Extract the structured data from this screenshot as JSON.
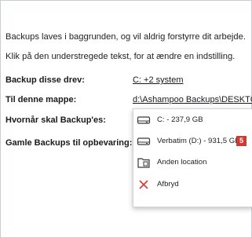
{
  "intro": {
    "line1": "Backups laves i baggrunden, og vil aldrig forstyrre dit arbejde.",
    "line2": "Klik på den understregede tekst, for at ændre en indstilling."
  },
  "settings": [
    {
      "label": "Backup disse drev:",
      "value": "C: +2 system"
    },
    {
      "label": "Til denne mappe:",
      "value": "d:\\Ashampoo Backups\\DESKTC"
    },
    {
      "label": "Hvornår skal Backup'es:",
      "value": ""
    },
    {
      "label": "Gamle Backups til opbevaring:",
      "value": ""
    }
  ],
  "dropdown": {
    "items": [
      {
        "label": "C: - 237,9 GB",
        "icon": "drive-icon"
      },
      {
        "label": "Verbatim (D:) - 931,5 GB",
        "icon": "drive-icon",
        "badge": "5"
      },
      {
        "label": "Anden location",
        "icon": "folder-icon"
      },
      {
        "label": "Afbryd",
        "icon": "close-icon"
      }
    ]
  },
  "colors": {
    "badge": "#d9362f",
    "close_icon": "#e0362c"
  }
}
